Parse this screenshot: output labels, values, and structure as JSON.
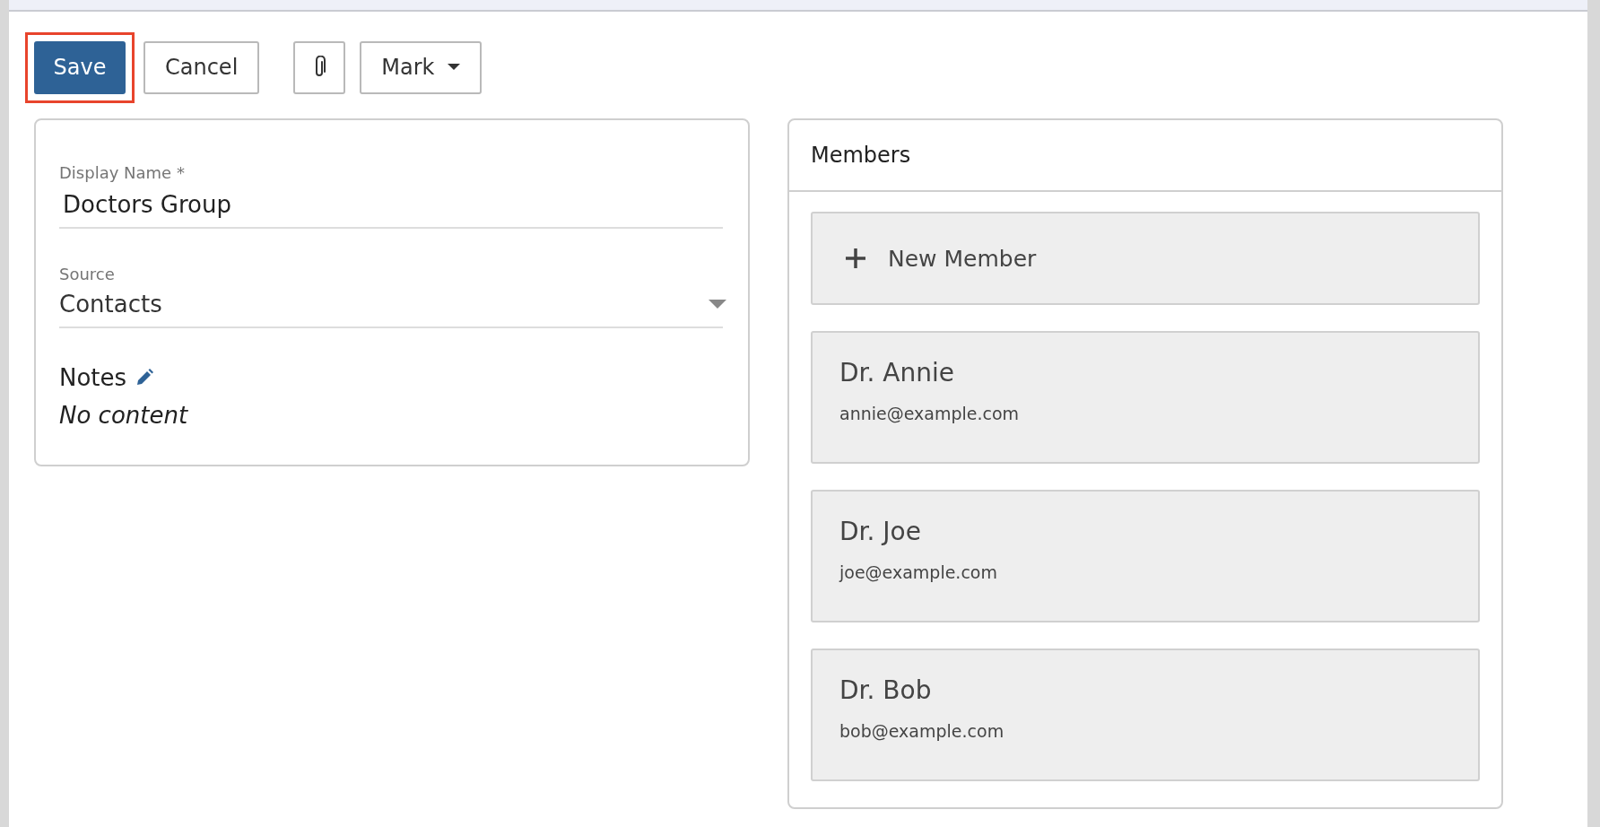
{
  "toolbar": {
    "save": {
      "label": "Save",
      "highlighted": true
    },
    "cancel": {
      "label": "Cancel"
    },
    "mark": {
      "label": "Mark"
    }
  },
  "form": {
    "fields": [
      {
        "kind": "text",
        "label": "Display Name *",
        "value": "Doctors Group"
      },
      {
        "kind": "select",
        "label": "Source",
        "value": "Contacts"
      }
    ],
    "notes": {
      "label": "Notes",
      "value": "No content"
    }
  },
  "members": {
    "title": "Members",
    "new_member": "New Member",
    "items": [
      {
        "name": "Dr. Annie",
        "email": "annie@example.com"
      },
      {
        "name": "Dr. Joe",
        "email": "joe@example.com"
      },
      {
        "name": "Dr. Bob",
        "email": "bob@example.com"
      }
    ]
  }
}
